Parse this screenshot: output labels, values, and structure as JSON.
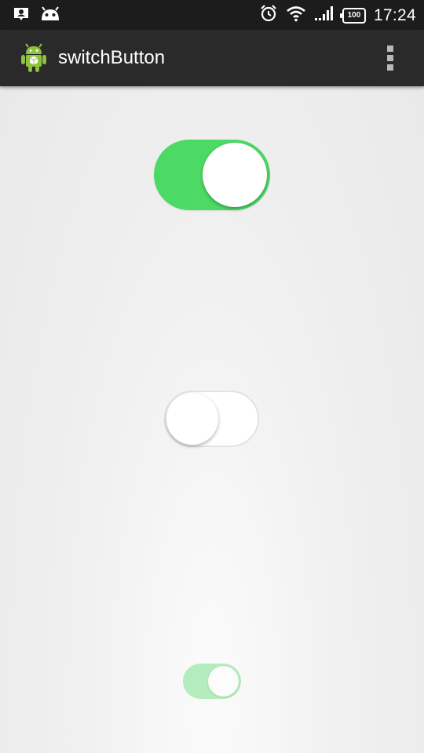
{
  "status_bar": {
    "time": "17:24",
    "battery_level": "100",
    "left_icons": [
      "notification-icon",
      "android-debug-icon"
    ],
    "right_icons": [
      "alarm-icon",
      "wifi-icon",
      "signal-icon",
      "battery-icon"
    ]
  },
  "action_bar": {
    "title": "switchButton",
    "app_icon": "android-robot-icon",
    "menu_icon": "overflow-menu-icon"
  },
  "switches": [
    {
      "id": "large",
      "checked": true,
      "enabled": true
    },
    {
      "id": "medium",
      "checked": false,
      "enabled": true
    },
    {
      "id": "small",
      "checked": true,
      "enabled": false
    }
  ],
  "colors": {
    "accent_on": "#4cd964",
    "status_bar_bg": "#1c1c1c",
    "action_bar_bg": "#2a2a2a",
    "background": "#ececec"
  }
}
